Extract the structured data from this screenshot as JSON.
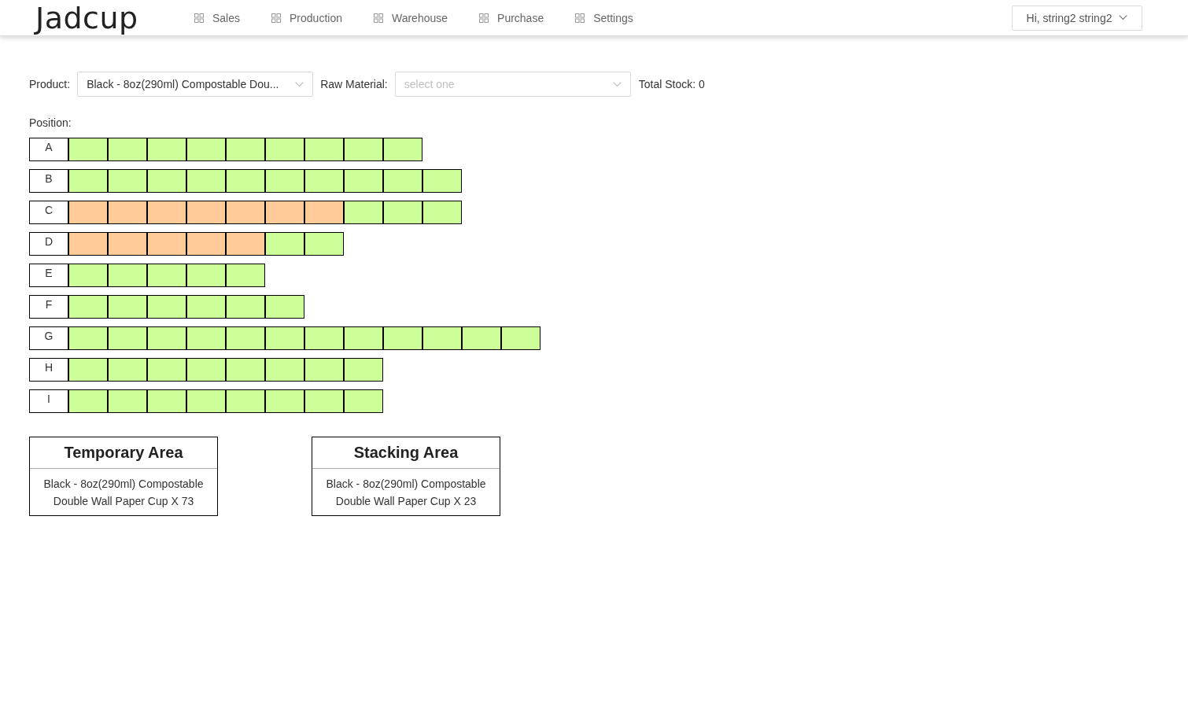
{
  "header": {
    "logo": "Jadcup",
    "nav": [
      {
        "label": "Sales"
      },
      {
        "label": "Production"
      },
      {
        "label": "Warehouse"
      },
      {
        "label": "Purchase"
      },
      {
        "label": "Settings"
      }
    ],
    "user_menu": {
      "label": "Hi, string2 string2"
    }
  },
  "filters": {
    "product": {
      "label": "Product:",
      "value": "Black - 8oz(290ml) Compostable Dou..."
    },
    "raw_material": {
      "label": "Raw Material:",
      "placeholder": "select one"
    },
    "total_stock": "Total Stock: 0"
  },
  "positions": {
    "label": "Position:",
    "rows": [
      {
        "label": "A",
        "slots": [
          {
            "color": "#ccff99"
          },
          {
            "color": "#ccff99"
          },
          {
            "color": "#ccff99"
          },
          {
            "color": "#ccff99"
          },
          {
            "color": "#ccff99"
          },
          {
            "color": "#ccff99"
          },
          {
            "color": "#ccff99"
          },
          {
            "color": "#ccff99"
          },
          {
            "color": "#ccff99"
          }
        ]
      },
      {
        "label": "B",
        "slots": [
          {
            "color": "#ccff99"
          },
          {
            "color": "#ccff99"
          },
          {
            "color": "#ccff99"
          },
          {
            "color": "#ccff99"
          },
          {
            "color": "#ccff99"
          },
          {
            "color": "#ccff99"
          },
          {
            "color": "#ccff99"
          },
          {
            "color": "#ccff99"
          },
          {
            "color": "#ccff99"
          },
          {
            "color": "#ccff99"
          }
        ]
      },
      {
        "label": "C",
        "slots": [
          {
            "color": "#ffcc99"
          },
          {
            "color": "#ffcc99"
          },
          {
            "color": "#ffcc99"
          },
          {
            "color": "#ffcc99"
          },
          {
            "color": "#ffcc99"
          },
          {
            "color": "#ffcc99"
          },
          {
            "color": "#ffcc99"
          },
          {
            "color": "#ccff99"
          },
          {
            "color": "#ccff99"
          },
          {
            "color": "#ccff99"
          }
        ]
      },
      {
        "label": "D",
        "slots": [
          {
            "color": "#ffcc99"
          },
          {
            "color": "#ffcc99"
          },
          {
            "color": "#ffcc99"
          },
          {
            "color": "#ffcc99"
          },
          {
            "color": "#ffcc99"
          },
          {
            "color": "#ccff99"
          },
          {
            "color": "#ccff99"
          }
        ]
      },
      {
        "label": "E",
        "slots": [
          {
            "color": "#ccff99"
          },
          {
            "color": "#ccff99"
          },
          {
            "color": "#ccff99"
          },
          {
            "color": "#ccff99"
          },
          {
            "color": "#ccff99"
          }
        ]
      },
      {
        "label": "F",
        "slots": [
          {
            "color": "#ccff99"
          },
          {
            "color": "#ccff99"
          },
          {
            "color": "#ccff99"
          },
          {
            "color": "#ccff99"
          },
          {
            "color": "#ccff99"
          },
          {
            "color": "#ccff99"
          }
        ]
      },
      {
        "label": "G",
        "slots": [
          {
            "color": "#ccff99"
          },
          {
            "color": "#ccff99"
          },
          {
            "color": "#ccff99"
          },
          {
            "color": "#ccff99"
          },
          {
            "color": "#ccff99"
          },
          {
            "color": "#ccff99"
          },
          {
            "color": "#ccff99"
          },
          {
            "color": "#ccff99"
          },
          {
            "color": "#ccff99"
          },
          {
            "color": "#ccff99"
          },
          {
            "color": "#ccff99"
          },
          {
            "color": "#ccff99"
          }
        ]
      },
      {
        "label": "H",
        "slots": [
          {
            "color": "#ccff99"
          },
          {
            "color": "#ccff99"
          },
          {
            "color": "#ccff99"
          },
          {
            "color": "#ccff99"
          },
          {
            "color": "#ccff99"
          },
          {
            "color": "#ccff99"
          },
          {
            "color": "#ccff99"
          },
          {
            "color": "#ccff99"
          }
        ]
      },
      {
        "label": "I",
        "slots": [
          {
            "color": "#ccff99"
          },
          {
            "color": "#ccff99"
          },
          {
            "color": "#ccff99"
          },
          {
            "color": "#ccff99"
          },
          {
            "color": "#ccff99"
          },
          {
            "color": "#ccff99"
          },
          {
            "color": "#ccff99"
          },
          {
            "color": "#ccff99"
          }
        ]
      }
    ]
  },
  "areas": [
    {
      "title": "Temporary Area",
      "content": "Black - 8oz(290ml) Compostable Double Wall Paper Cup X 73"
    },
    {
      "title": "Stacking Area",
      "content": "Black - 8oz(290ml) Compostable Double Wall Paper Cup X 23"
    }
  ]
}
